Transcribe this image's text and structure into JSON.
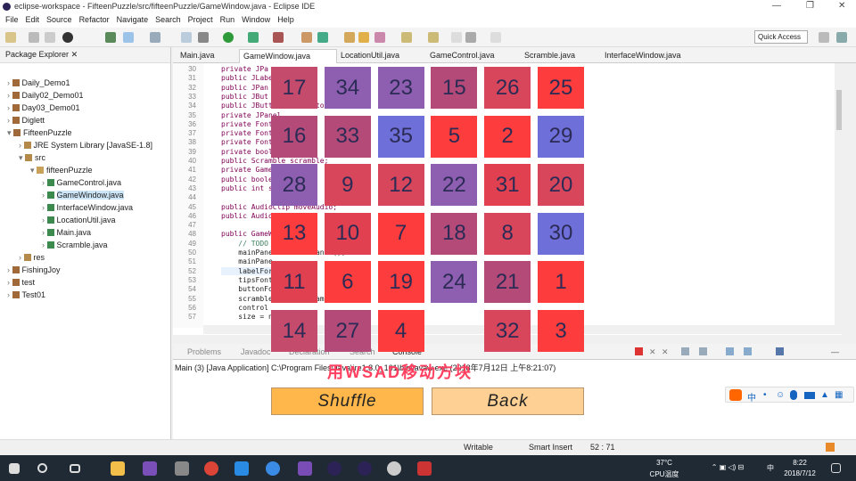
{
  "window": {
    "title": "eclipse-workspace - FifteenPuzzle/src/fifteenPuzzle/GameWindow.java - Eclipse IDE",
    "controls": [
      "—",
      "❐",
      "✕"
    ]
  },
  "menu": [
    "File",
    "Edit",
    "Source",
    "Refactor",
    "Navigate",
    "Search",
    "Project",
    "Run",
    "Window",
    "Help"
  ],
  "quick_access": "Quick Access",
  "package_explorer": {
    "title": "Package Explorer",
    "items": [
      {
        "label": "Daily_Demo1",
        "depth": 0
      },
      {
        "label": "Daily02_Demo01",
        "depth": 0
      },
      {
        "label": "Day03_Demo01",
        "depth": 0
      },
      {
        "label": "Diglett",
        "depth": 0
      },
      {
        "label": "FifteenPuzzle",
        "depth": 0
      },
      {
        "label": "JRE System Library [JavaSE-1.8]",
        "depth": 1
      },
      {
        "label": "src",
        "depth": 1
      },
      {
        "label": "fifteenPuzzle",
        "depth": 2
      },
      {
        "label": "GameControl.java",
        "depth": 3
      },
      {
        "label": "GameWindow.java",
        "depth": 3
      },
      {
        "label": "InterfaceWindow.java",
        "depth": 3
      },
      {
        "label": "LocationUtil.java",
        "depth": 3
      },
      {
        "label": "Main.java",
        "depth": 3
      },
      {
        "label": "Scramble.java",
        "depth": 3
      },
      {
        "label": "res",
        "depth": 1
      },
      {
        "label": "FishingJoy",
        "depth": 0
      },
      {
        "label": "test",
        "depth": 0
      },
      {
        "label": "Test01",
        "depth": 0
      }
    ]
  },
  "editor_tabs": [
    "Main.java",
    "GameWindow.java",
    "LocationUtil.java",
    "GameControl.java",
    "Scramble.java",
    "InterfaceWindow.java"
  ],
  "editor": {
    "line_numbers": [
      "30",
      "31",
      "32",
      "33",
      "34",
      "35",
      "36",
      "37",
      "38",
      "39",
      "40",
      "41",
      "42",
      "43",
      "44",
      "45",
      "46",
      "47",
      "48",
      "49",
      "50",
      "51",
      "52",
      "53",
      "54",
      "55",
      "56",
      "57"
    ],
    "lines": [
      "private JPa",
      "public JLabe",
      "public JPan",
      "public JBut",
      "public JButton backButton;",
      "private JPanel",
      "private Font",
      "private Font",
      "private Font",
      "private boole",
      "public Scramble scramble;",
      "private Game",
      "public boole",
      "public int s",
      "",
      "public AudioClip moveAudio;",
      "public Audio",
      "",
      "public GameW",
      "    // TODO",
      "    mainPanel = new JPanel();",
      "    mainPane",
      "    labelFor",
      "    tipsFont",
      "    buttonFo",
      "    scramble = new Scramble(n);",
      "    control",
      "    size = n"
    ]
  },
  "console": {
    "tabs": [
      "Problems",
      "Javadoc",
      "Declaration",
      "Search",
      "Console"
    ],
    "launch": "Main (3) [Java Application] C:\\Program Files\\Java\\jre1.8.0_161\\bin\\javaw.exe (2018年7月12日 上午8:21:07)",
    "overlay_text": "用WSAD移动方块"
  },
  "puzzle": {
    "columns": 6,
    "cells": [
      "17",
      "34",
      "23",
      "15",
      "26",
      "25",
      "16",
      "33",
      "35",
      "5",
      "2",
      "29",
      "28",
      "9",
      "12",
      "22",
      "31",
      "20",
      "13",
      "10",
      "7",
      "18",
      "8",
      "30",
      "11",
      "6",
      "19",
      "24",
      "21",
      "1",
      "14",
      "27",
      "4",
      "",
      "32",
      "3"
    ],
    "colors": [
      "#c44b6b",
      "#8e5fb0",
      "#8e5fb0",
      "#b44a78",
      "#d8465c",
      "#fd3d3d",
      "#b44a78",
      "#b44a78",
      "#6e6fd8",
      "#fd3d3d",
      "#fd3d3d",
      "#6e6fd8",
      "#8e5fb0",
      "#d8465c",
      "#d8465c",
      "#8e5fb0",
      "#e0404f",
      "#d8465c",
      "#fd3d3d",
      "#e0404f",
      "#fd3d3d",
      "#b44a78",
      "#d8465c",
      "#6e6fd8",
      "#e0404f",
      "#fd3d3d",
      "#fd3d3d",
      "#8e5fb0",
      "#b44a78",
      "#fd3d3d",
      "#c44b6b",
      "#b44a78",
      "#fd3d3d",
      "",
      "#d8465c",
      "#fd3d3d"
    ],
    "shuffle_label": "Shuffle",
    "back_label": "Back",
    "shuffle_color": "#ffb74b",
    "back_color": "#ffd093"
  },
  "status": {
    "writable": "Writable",
    "insert_mode": "Smart Insert",
    "position": "52 : 71"
  },
  "taskbar": {
    "temp": "37°C",
    "cpu": "CPU温度",
    "ime": "中",
    "time": "8:22",
    "date": "2018/7/12"
  }
}
